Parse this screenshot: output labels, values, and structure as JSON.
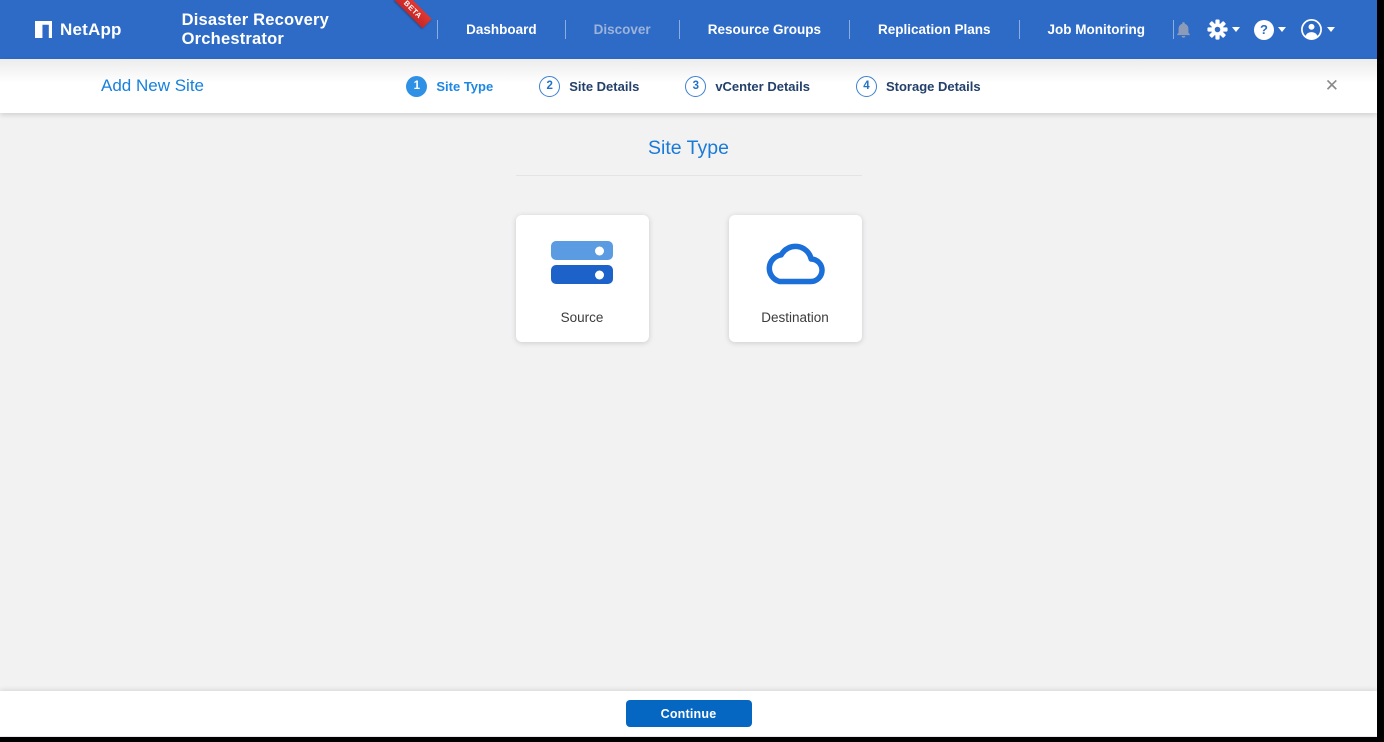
{
  "header": {
    "brand": "NetApp",
    "app_title": "Disaster Recovery Orchestrator",
    "beta_badge": "BETA",
    "nav": [
      {
        "label": "Dashboard",
        "state": "normal"
      },
      {
        "label": "Discover",
        "state": "current"
      },
      {
        "label": "Resource Groups",
        "state": "normal"
      },
      {
        "label": "Replication Plans",
        "state": "normal"
      },
      {
        "label": "Job Monitoring",
        "state": "normal"
      }
    ],
    "help_glyph": "?",
    "icons": {
      "bell": "notifications-bell-icon",
      "gear": "settings-gear-icon",
      "help": "help-icon",
      "user": "user-account-icon"
    }
  },
  "wizard": {
    "title": "Add New Site",
    "steps": [
      {
        "number": "1",
        "label": "Site Type",
        "state": "active"
      },
      {
        "number": "2",
        "label": "Site Details",
        "state": "upcoming"
      },
      {
        "number": "3",
        "label": "vCenter Details",
        "state": "upcoming"
      },
      {
        "number": "4",
        "label": "Storage Details",
        "state": "upcoming"
      }
    ],
    "close_glyph": "✕"
  },
  "main": {
    "heading": "Site Type",
    "options": [
      {
        "label": "Source",
        "icon": "server-stack-icon"
      },
      {
        "label": "Destination",
        "icon": "cloud-icon"
      }
    ]
  },
  "footer": {
    "continue_label": "Continue"
  },
  "colors": {
    "header_blue": "#2e6bc6",
    "accent_blue": "#1a7ad8",
    "step_active_blue": "#2e91e5",
    "button_blue": "#0667c3",
    "server_bar_light": "#5b9be2",
    "server_bar_dark": "#1d62c9",
    "cloud_blue": "#1b6fd8",
    "beta_red": "#d93025",
    "muted_nav": "#9cb3da"
  }
}
